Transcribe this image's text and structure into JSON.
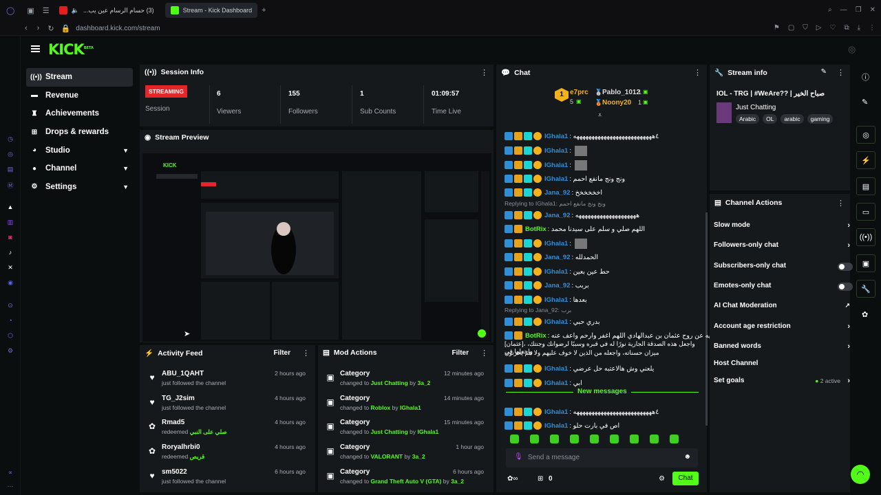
{
  "browser": {
    "tab1_title": "(3) حسام الرسام عين يب...",
    "tab2_title": "Stream - Kick Dashboard",
    "url": "dashboard.kick.com/stream"
  },
  "logo": {
    "text": "KICK",
    "sup": "BETA"
  },
  "nav": [
    {
      "label": "Stream",
      "icon": "broadcast-icon"
    },
    {
      "label": "Revenue",
      "icon": "wallet-icon"
    },
    {
      "label": "Achievements",
      "icon": "trophy-icon"
    },
    {
      "label": "Drops & rewards",
      "icon": "gift-icon"
    },
    {
      "label": "Studio",
      "icon": "palette-icon"
    },
    {
      "label": "Channel",
      "icon": "user-icon"
    },
    {
      "label": "Settings",
      "icon": "gear-icon"
    }
  ],
  "session": {
    "title": "Session Info",
    "status_badge": "STREAMING",
    "status_label": "Session",
    "viewers": "6",
    "viewers_label": "Viewers",
    "followers": "155",
    "followers_label": "Followers",
    "subs": "1",
    "subs_label": "Sub Counts",
    "time": "01:09:57",
    "time_label": "Time Live"
  },
  "preview": {
    "title": "Stream Preview"
  },
  "activity": {
    "title": "Activity Feed",
    "filter": "Filter",
    "items": [
      {
        "name": "ABU_1QAHT",
        "sub": "just followed the channel",
        "time": "2 hours ago",
        "icon": "heart-icon",
        "reward": ""
      },
      {
        "name": "TG_J2sim",
        "sub": "just followed the channel",
        "time": "4 hours ago",
        "icon": "heart-icon",
        "reward": ""
      },
      {
        "name": "Rmad5",
        "sub": "redeemed",
        "time": "4 hours ago",
        "icon": "redeem-icon",
        "reward": "صلي على النبي"
      },
      {
        "name": "Roryalhrbi0",
        "sub": "redeemed",
        "time": "4 hours ago",
        "icon": "redeem-icon",
        "reward": "قريص"
      },
      {
        "name": "sm5022",
        "sub": "just followed the channel",
        "time": "6 hours ago",
        "icon": "heart-icon",
        "reward": ""
      }
    ]
  },
  "mod": {
    "title": "Mod Actions",
    "filter": "Filter",
    "items": [
      {
        "title": "Category",
        "pre": "changed to",
        "value": "Just Chatting",
        "by": "by",
        "user": "3a_2",
        "time": "12 minutes ago"
      },
      {
        "title": "Category",
        "pre": "changed to",
        "value": "Roblox",
        "by": "by",
        "user": "IGhala1",
        "time": "14 minutes ago"
      },
      {
        "title": "Category",
        "pre": "changed to",
        "value": "Just Chatting",
        "by": "by",
        "user": "IGhala1",
        "time": "15 minutes ago"
      },
      {
        "title": "Category",
        "pre": "changed to",
        "value": "VALORANT",
        "by": "by",
        "user": "3a_2",
        "time": "1 hour ago"
      },
      {
        "title": "Category",
        "pre": "changed to",
        "value": "Grand Theft Auto V (GTA)",
        "by": "by",
        "user": "3a_2",
        "time": "6 hours ago"
      }
    ]
  },
  "chat": {
    "title": "Chat",
    "top_gifter1": "e7prc",
    "top_gifter1_count": "5",
    "top_gifter2": "Pablo_1012",
    "top_gifter2_count": "1",
    "top_gifter3": "Noony20",
    "top_gifter3_count": "1",
    "new_messages": "New messages",
    "input_placeholder": "Send a message",
    "points": "0",
    "send": "Chat",
    "messages": [
      {
        "user": "IGhala1",
        "text": ": ٤ههههههههههههههههههههههههههه",
        "color": "#2e8fd6",
        "img": false,
        "reply": ""
      },
      {
        "user": "IGhala1",
        "text": ":",
        "color": "#2e8fd6",
        "img": true,
        "reply": ""
      },
      {
        "user": "IGhala1",
        "text": ":",
        "color": "#2e8fd6",
        "img": true,
        "reply": ""
      },
      {
        "user": "IGhala1",
        "text": ": ونج ونج مانفع احمم",
        "color": "#2e8fd6",
        "img": false,
        "reply": ""
      },
      {
        "user": "Jana_92",
        "text": ": اخخخخخخ",
        "color": "#2e8fd6",
        "img": false,
        "reply": ""
      },
      {
        "user": "Jana_92",
        "text": ": ههههههههههههههههههههه",
        "color": "#2e8fd6",
        "img": false,
        "reply": "Replying to IGhala1: ونج ونج مانفع احمم"
      },
      {
        "user": "BotRix",
        "text": ": اللهم صلي و سلم على سيدنا محمد",
        "color": "#53fc18",
        "img": false,
        "reply": ""
      },
      {
        "user": "IGhala1",
        "text": ":",
        "color": "#2e8fd6",
        "img": true,
        "reply": ""
      },
      {
        "user": "Jana_92",
        "text": ": الحمدلله",
        "color": "#2e8fd6",
        "img": false,
        "reply": ""
      },
      {
        "user": "IGhala1",
        "text": ": حط عين بعين",
        "color": "#2e8fd6",
        "img": false,
        "reply": ""
      },
      {
        "user": "Jana_92",
        "text": ": بربب",
        "color": "#2e8fd6",
        "img": false,
        "reply": ""
      },
      {
        "user": "IGhala1",
        "text": ": بعدها",
        "color": "#2e8fd6",
        "img": false,
        "reply": ""
      },
      {
        "user": "IGhala1",
        "text": ": بدري حبي",
        "color": "#2e8fd6",
        "img": false,
        "reply": "Replying to Jana_92: برب"
      },
      {
        "user": "BotRix",
        "text": ": صدقه جاريه عن روح عثمان بن عبدالهادي اللهم اغفر وارحم واعف عنه",
        "color": "#53fc18",
        "img": false,
        "reply": ""
      },
      {
        "user": "IGhala1",
        "text": ": يلعني وش هالاعتبه حل عرضي",
        "color": "#2e8fd6",
        "img": false,
        "reply": ""
      },
      {
        "user": "IGhala1",
        "text": ": ابي",
        "color": "#2e8fd6",
        "img": false,
        "reply": ""
      },
      {
        "user": "IGhala1",
        "text": ": ٤ههههههههههههههههههههههههههه",
        "color": "#2e8fd6",
        "img": false,
        "reply": ""
      },
      {
        "user": "IGhala1",
        "text": ": اص في بارت حلو",
        "color": "#2e8fd6",
        "img": false,
        "reply": ""
      }
    ],
    "botrix_cont1": "[عثمان]، واجعل هذه الصدقة الجارية نورًا له في قبره وسببًا لرضوانك وجنتك، واجعلها في",
    "botrix_cont2": "ميزان حسناته، واجعله من الذين لا خوف عليهم ولا هم يحزنون"
  },
  "streaminfo": {
    "title": "Stream info",
    "stream_title": "IOL - TRG | #WeAre?? | صباح الخير",
    "category": "Just Chatting",
    "tags": [
      "Arabic",
      "OL",
      "arabic",
      "gaming"
    ]
  },
  "actions": {
    "title": "Channel Actions",
    "items": [
      {
        "label": "Slow mode",
        "kind": "arrow"
      },
      {
        "label": "Followers-only chat",
        "kind": "arrow"
      },
      {
        "label": "Subscribers-only chat",
        "kind": "toggle"
      },
      {
        "label": "Emotes-only chat",
        "kind": "toggle"
      },
      {
        "label": "AI Chat Moderation",
        "kind": "external"
      },
      {
        "label": "Account age restriction",
        "kind": "arrow"
      },
      {
        "label": "Banned words",
        "kind": "arrow"
      },
      {
        "label": "Host Channel",
        "kind": "none"
      },
      {
        "label": "Set goals",
        "kind": "arrow"
      }
    ],
    "goals_active": "2 active"
  },
  "colors": {
    "accent": "#53fc18",
    "live": "#e5242b",
    "panel": "#16191c"
  }
}
